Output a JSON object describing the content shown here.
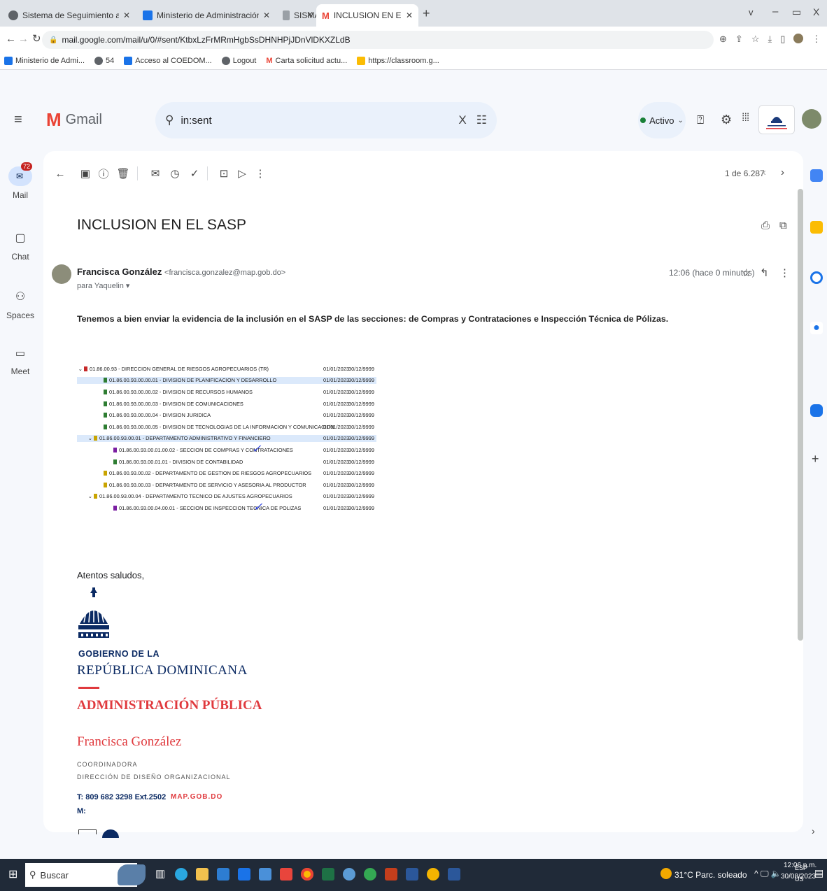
{
  "browser": {
    "tabs": [
      {
        "title": "Sistema de Seguimiento a Solicit",
        "favicon": "globe-icon",
        "color": "#5f6368"
      },
      {
        "title": "Ministerio de Administración Púb",
        "favicon": "gov-icon",
        "color": "#1a73e8"
      },
      {
        "title": "SISMAP",
        "favicon": "doc-icon",
        "color": "#9aa0a6"
      },
      {
        "title": "INCLUSION EN EL SASP - francis",
        "favicon": "gmail-icon",
        "color": "#ea4335",
        "active": true
      }
    ],
    "new_tab": "+",
    "window_controls": [
      "v",
      "–",
      "ᗜ",
      "X"
    ],
    "url": "mail.google.com/mail/u/0/#sent/KtbxLzFrMRmHgbSsDHNHPjJDnVlDKXZLdB",
    "bookmarks": [
      {
        "label": "Ministerio de Admi...",
        "color": "#1a73e8"
      },
      {
        "label": "54",
        "color": "#5f6368"
      },
      {
        "label": "Acceso al COEDOM...",
        "color": "#1a73e8"
      },
      {
        "label": "Logout",
        "color": "#5f6368"
      },
      {
        "label": "Carta solicitud actu...",
        "color": "#ea4335"
      },
      {
        "label": "https://classroom.g...",
        "color": "#fbbc04"
      }
    ]
  },
  "gmail": {
    "brand": "Gmail",
    "search_value": "in:sent",
    "status": "Activo",
    "rail": [
      {
        "label": "Mail",
        "icon": "mail-icon",
        "badge": "72"
      },
      {
        "label": "Chat",
        "icon": "chat-icon"
      },
      {
        "label": "Spaces",
        "icon": "spaces-icon"
      },
      {
        "label": "Meet",
        "icon": "meet-icon"
      }
    ],
    "pagination": "1 de 6.287",
    "subject": "INCLUSION EN EL SASP",
    "sender_name": "Francisca González",
    "sender_email": "<francisca.gonzalez@map.gob.do>",
    "recipient": "para Yaquelin ▾",
    "time": "12:06 (hace 0 minutos)",
    "body_text": "Tenemos a bien enviar la evidencia de la inclusión en el SASP de las secciones: de Compras y Contrataciones e Inspección Técnica de Pólizas.",
    "closing": "Atentos saludos,"
  },
  "org_table": [
    {
      "text": "01.86.00.93 - DIRECCION GENERAL DE RIESGOS AGROPECUARIOS (TR)",
      "color": "#c62828",
      "chev": true,
      "indent": 0,
      "d1": "01/01/2023",
      "d2": "30/12/9999"
    },
    {
      "text": "01.86.00.93.00.00.01 - DIVISION DE PLANIFICACION Y DESARROLLO",
      "color": "#2e7d32",
      "indent": 2,
      "hl": true,
      "d1": "01/01/2023",
      "d2": "30/12/9999"
    },
    {
      "text": "01.86.00.93.00.00.02 - DIVISION DE RECURSOS HUMANOS",
      "color": "#2e7d32",
      "indent": 2,
      "d1": "01/01/2023",
      "d2": "30/12/9999"
    },
    {
      "text": "01.86.00.93.00.00.03 - DIVISION DE COMUNICACIONES",
      "color": "#2e7d32",
      "indent": 2,
      "d1": "01/01/2023",
      "d2": "30/12/9999"
    },
    {
      "text": "01.86.00.93.00.00.04 - DIVISION JURIDICA",
      "color": "#2e7d32",
      "indent": 2,
      "d1": "01/01/2023",
      "d2": "30/12/9999"
    },
    {
      "text": "01.86.00.93.00.00.05 - DIVISION DE TECNOLOGIAS DE LA INFORMACION Y COMUNICACION",
      "color": "#2e7d32",
      "indent": 2,
      "d1": "01/01/2023",
      "d2": "30/12/9999"
    },
    {
      "text": "01.86.00.93.00.01 - DEPARTAMENTO ADMINISTRATIVO Y FINANCIERO",
      "color": "#c9a400",
      "chev": true,
      "indent": 1,
      "hl": true,
      "d1": "01/01/2023",
      "d2": "30/12/9999"
    },
    {
      "text": "01.86.00.93.00.01.00.02 - SECCION DE COMPRAS Y CONTRATACIONES",
      "color": "#7b1fa2",
      "indent": 3,
      "d1": "01/01/2023",
      "d2": "30/12/9999",
      "check": true
    },
    {
      "text": "01.86.00.93.00.01.01 - DIVISION DE CONTABILIDAD",
      "color": "#2e7d32",
      "indent": 3,
      "d1": "01/01/2023",
      "d2": "30/12/9999"
    },
    {
      "text": "01.86.00.93.00.02 - DEPARTAMENTO DE GESTION DE RIESGOS AGROPECUARIOS",
      "color": "#c9a400",
      "indent": 2,
      "d1": "01/01/2023",
      "d2": "30/12/9999"
    },
    {
      "text": "01.86.00.93.00.03 - DEPARTAMENTO DE SERVICIO Y ASESORIA AL PRODUCTOR",
      "color": "#c9a400",
      "indent": 2,
      "d1": "01/01/2023",
      "d2": "30/12/9999"
    },
    {
      "text": "01.86.00.93.00.04 - DEPARTAMENTO TECNICO DE AJUSTES AGROPECUARIOS",
      "color": "#c9a400",
      "chev": true,
      "indent": 1,
      "d1": "01/01/2023",
      "d2": "30/12/9999"
    },
    {
      "text": "01.86.00.93.00.04.00.01 - SECCION DE INSPECCION TECNICA DE POLIZAS",
      "color": "#7b1fa2",
      "indent": 3,
      "d1": "01/01/2023",
      "d2": "30/12/9999",
      "check": true
    }
  ],
  "signature": {
    "gov_line1": "GOBIERNO DE LA",
    "gov_line2": "REPÚBLICA DOMINICANA",
    "admin": "ADMINISTRACIÓN PÚBLICA",
    "name": "Francisca González",
    "role": "COORDINADORA",
    "dept": "DIRECCIÓN DE DISEÑO ORGANIZACIONAL",
    "phone": "T: 809 682 3298 Ext.2502",
    "site": "MAP.GOB.DO",
    "mobile": "M:",
    "accent": "#e03a3e",
    "navy": "#0b2a63"
  },
  "taskbar": {
    "search": "Buscar",
    "weather": "31°C Parc. soleado",
    "lang1": "ESP",
    "lang2": "US",
    "time": "12:06 p.m.",
    "date": "30/08/2023"
  }
}
